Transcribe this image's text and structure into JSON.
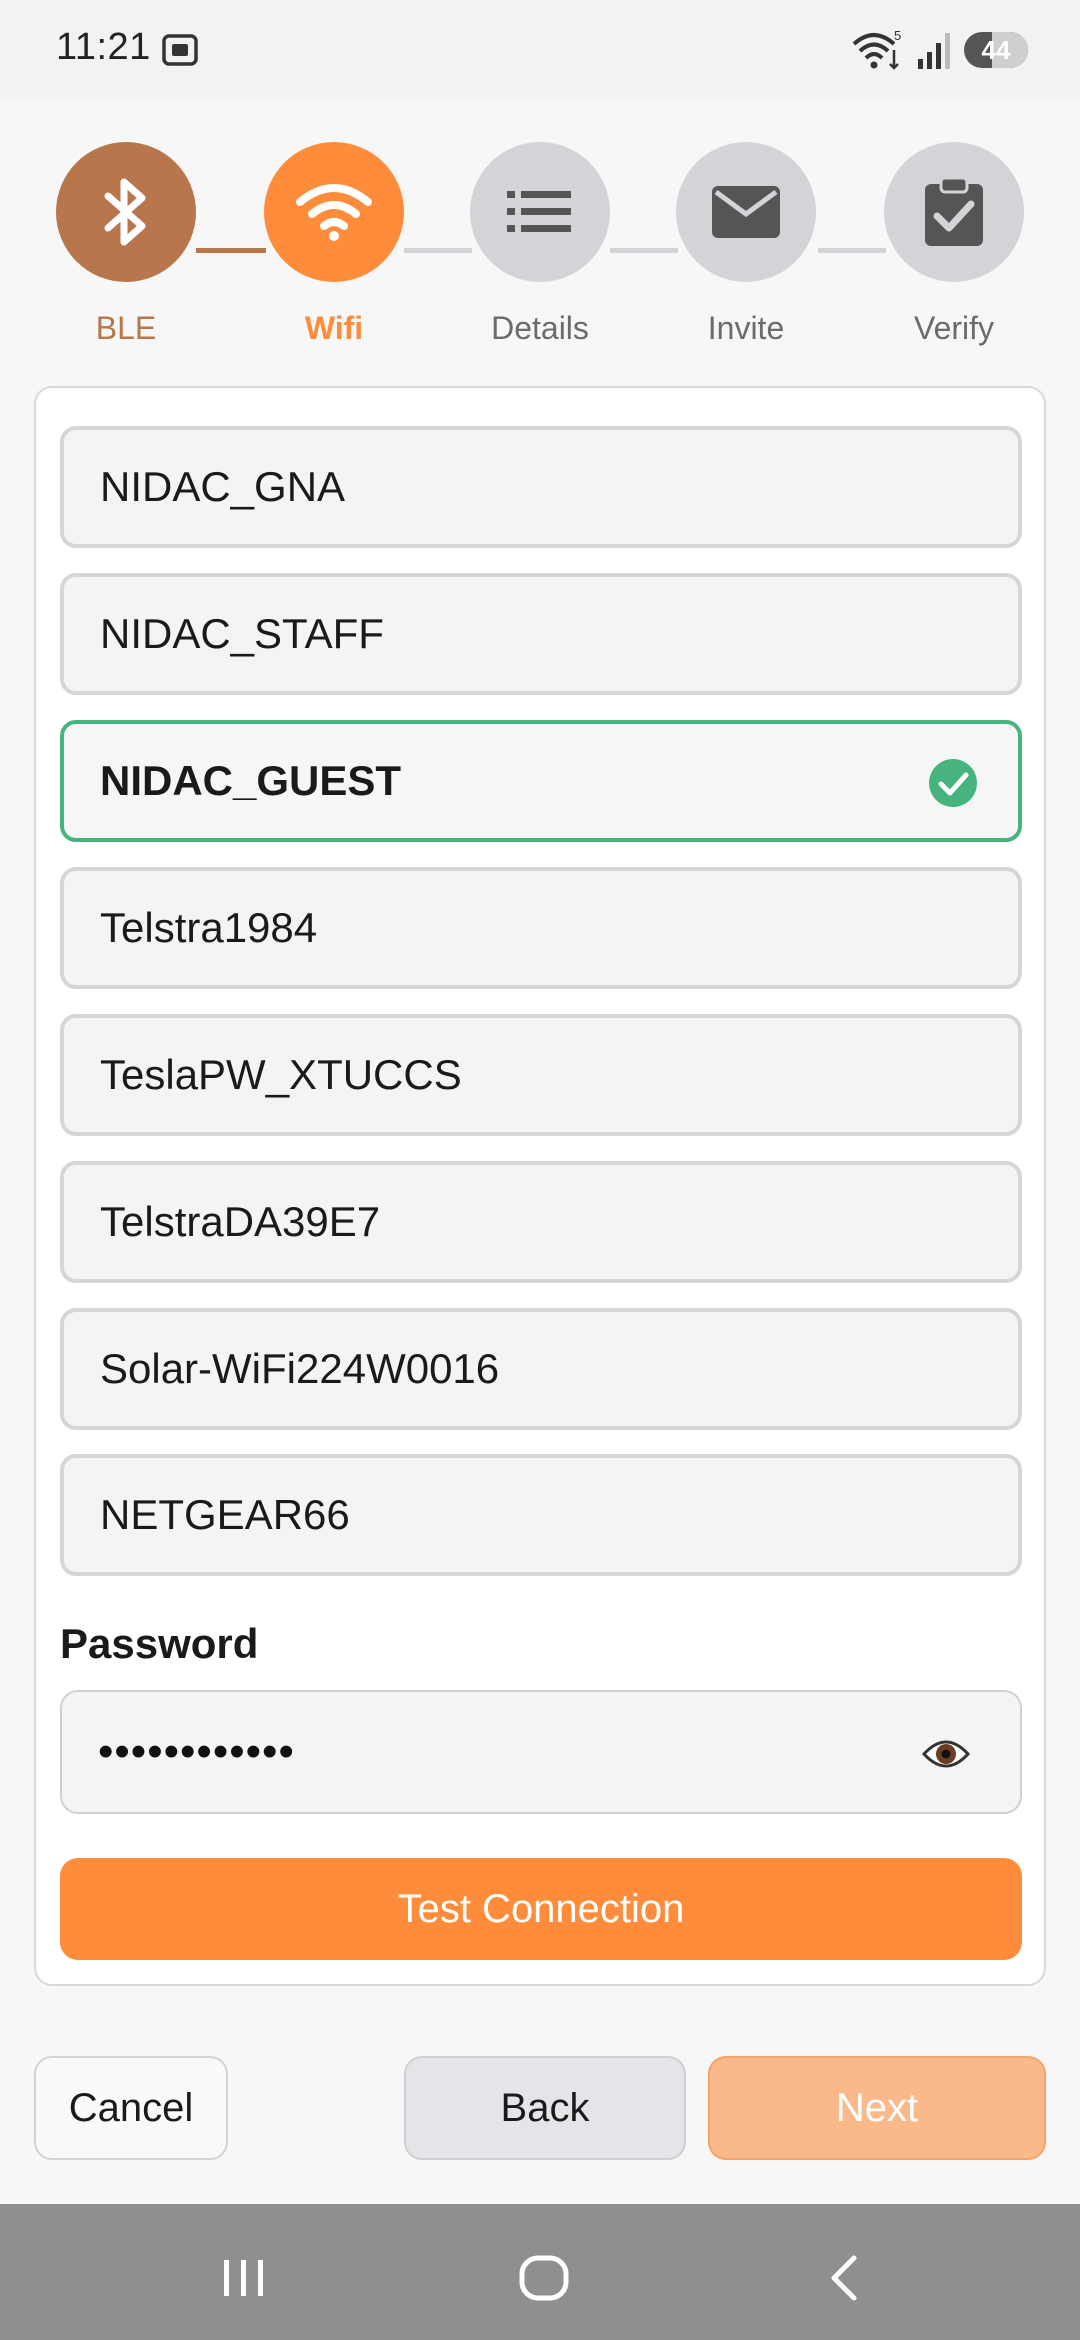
{
  "status_bar": {
    "time": "11:21",
    "battery": "44",
    "wifi_badge": "5"
  },
  "stepper": {
    "steps": [
      {
        "label": "BLE",
        "icon": "bluetooth-icon",
        "state": "done"
      },
      {
        "label": "Wifi",
        "icon": "wifi-icon",
        "state": "active"
      },
      {
        "label": "Details",
        "icon": "list-icon",
        "state": "pending"
      },
      {
        "label": "Invite",
        "icon": "envelope-icon",
        "state": "pending"
      },
      {
        "label": "Verify",
        "icon": "clipboard-check-icon",
        "state": "pending"
      }
    ]
  },
  "networks": [
    {
      "name": "NIDAC_GNA",
      "selected": false
    },
    {
      "name": "NIDAC_STAFF",
      "selected": false
    },
    {
      "name": "NIDAC_GUEST",
      "selected": true
    },
    {
      "name": "Telstra1984",
      "selected": false
    },
    {
      "name": "TeslaPW_XTUCCS",
      "selected": false
    },
    {
      "name": "TelstraDA39E7",
      "selected": false
    },
    {
      "name": "Solar-WiFi224W0016",
      "selected": false
    },
    {
      "name": "NETGEAR66",
      "selected": false
    }
  ],
  "password": {
    "label": "Password",
    "value": "••••••••••••"
  },
  "buttons": {
    "test_connection": "Test Connection",
    "cancel": "Cancel",
    "back": "Back",
    "next": "Next"
  },
  "colors": {
    "done": "#b8764c",
    "active": "#ff8c3a",
    "pending": "#d4d4d8",
    "selected_border": "#47b37f"
  }
}
